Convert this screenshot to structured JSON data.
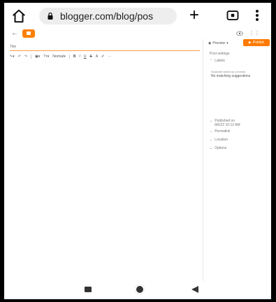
{
  "browser": {
    "url": "blogger.com/blog/pos",
    "icons": [
      "home-icon",
      "lock-icon",
      "plus-icon",
      "tabs-icon",
      "menu-icon"
    ]
  },
  "editor": {
    "title_placeholder": "Title",
    "toolbar": {
      "format_label": "Normal"
    },
    "sidebar": {
      "preview_label": "Preview",
      "publish_label": "Publish",
      "post_settings": "Post settings",
      "labels_title": "Labels",
      "labels_hint": "Separate labels by commas",
      "labels_no_suggestions": "No matching suggestions",
      "published_label": "Published on",
      "published_value": "8/6/22 10:12 AM",
      "permalink": "Permalink",
      "location": "Location",
      "options": "Options"
    }
  },
  "colors": {
    "brand_orange": "#ff7a00",
    "accent_orange_line": "#ff9a4a"
  }
}
